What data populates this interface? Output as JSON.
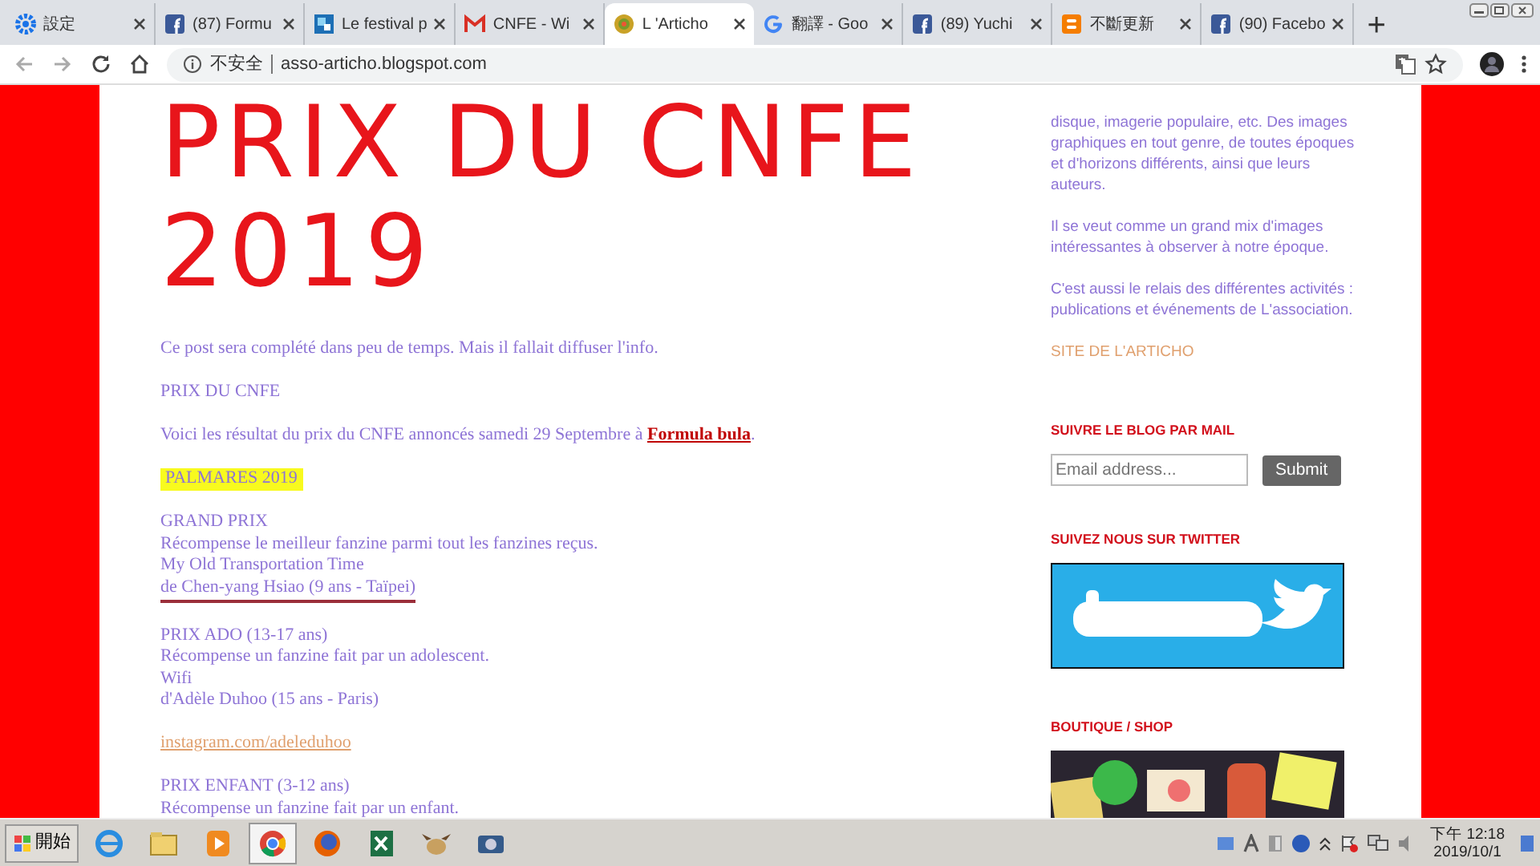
{
  "browser": {
    "tabs": [
      {
        "title": "設定",
        "kind": "gear",
        "selected": false
      },
      {
        "title": "(87) Formu",
        "kind": "facebook",
        "selected": false
      },
      {
        "title": "Le festival p",
        "kind": "tile",
        "selected": false
      },
      {
        "title": "CNFE - Wi",
        "kind": "mail",
        "selected": false
      },
      {
        "title": "L 'Articho",
        "kind": "flower",
        "selected": true
      },
      {
        "title": "翻譯 - Goo",
        "kind": "google",
        "selected": false
      },
      {
        "title": "(89) Yuchi",
        "kind": "facebook",
        "selected": false
      },
      {
        "title": "不斷更新",
        "kind": "blogger",
        "selected": false
      },
      {
        "title": "(90) Facebo",
        "kind": "facebook",
        "selected": false
      }
    ],
    "new_tab": "+",
    "address": {
      "security": "不安全",
      "url": "asso-articho.blogspot.com"
    }
  },
  "post": {
    "title_lines": [
      "PRIX DU CNFE",
      "2019"
    ],
    "blocks": [
      {
        "kind": "text",
        "lines": [
          {
            "text": "Ce post sera complété dans peu de temps. Mais il fallait diffuser l'info.",
            "underlined": false
          }
        ]
      },
      {
        "kind": "text",
        "lines": [
          {
            "text": "PRIX DU CNFE",
            "underlined": false
          }
        ]
      },
      {
        "kind": "announce",
        "text": "Voici les résultat du prix du CNFE annoncés samedi 29 Septembre à ",
        "link": "Formula bula",
        "after": "."
      },
      {
        "kind": "highlight",
        "text": "PALMARES 2019"
      },
      {
        "kind": "text",
        "lines": [
          {
            "text": "GRAND PRIX",
            "underlined": false
          },
          {
            "text": "Récompense le meilleur fanzine parmi tout les fanzines reçus.",
            "underlined": false
          },
          {
            "text": "My Old Transportation Time",
            "underlined": false
          },
          {
            "text": "de Chen-yang Hsiao (9 ans - Taïpei)",
            "underlined": true
          }
        ]
      },
      {
        "kind": "text",
        "lines": [
          {
            "text": "PRIX ADO (13-17 ans)",
            "underlined": false
          },
          {
            "text": "Récompense un fanzine fait par un adolescent.",
            "underlined": false
          },
          {
            "text": "Wifi",
            "underlined": false
          },
          {
            "text": "d'Adèle Duhoo (15 ans - Paris)",
            "underlined": false
          }
        ]
      },
      {
        "kind": "link",
        "text": "instagram.com/adeleduhoo"
      },
      {
        "kind": "text",
        "lines": [
          {
            "text": "PRIX ENFANT (3-12 ans)",
            "underlined": false
          },
          {
            "text": "Récompense un fanzine fait par un enfant.",
            "underlined": false
          }
        ]
      }
    ]
  },
  "sidebar": {
    "about": [
      [
        "disque, imagerie populaire, etc. Des images",
        "graphiques en tout genre, de toutes époques",
        "et d'horizons différents, ainsi que leurs",
        "auteurs."
      ],
      [
        "Il se veut comme un grand mix d'images",
        "intéressantes à observer à notre époque."
      ],
      [
        "C'est aussi le relais des différentes activités :",
        "publications et événements de L'association."
      ]
    ],
    "site_link": "SITE DE L'ARTICHO",
    "mail": {
      "heading": "SUIVRE LE BLOG PAR MAIL",
      "placeholder": "Email address...",
      "button": "Submit"
    },
    "twitter": {
      "heading": "SUIVEZ NOUS SUR TWITTER"
    },
    "shop": {
      "heading": "BOUTIQUE / SHOP"
    }
  },
  "taskbar": {
    "start": "開始",
    "apps": [
      {
        "kind": "ie",
        "selected": false
      },
      {
        "kind": "folder",
        "selected": false
      },
      {
        "kind": "media",
        "selected": false
      },
      {
        "kind": "chrome",
        "selected": true
      },
      {
        "kind": "firefox",
        "selected": false
      },
      {
        "kind": "excel",
        "selected": false
      },
      {
        "kind": "bird",
        "selected": false
      },
      {
        "kind": "camera",
        "selected": false
      }
    ],
    "clock": {
      "time": "下午 12:18",
      "date": "2019/10/1"
    }
  }
}
